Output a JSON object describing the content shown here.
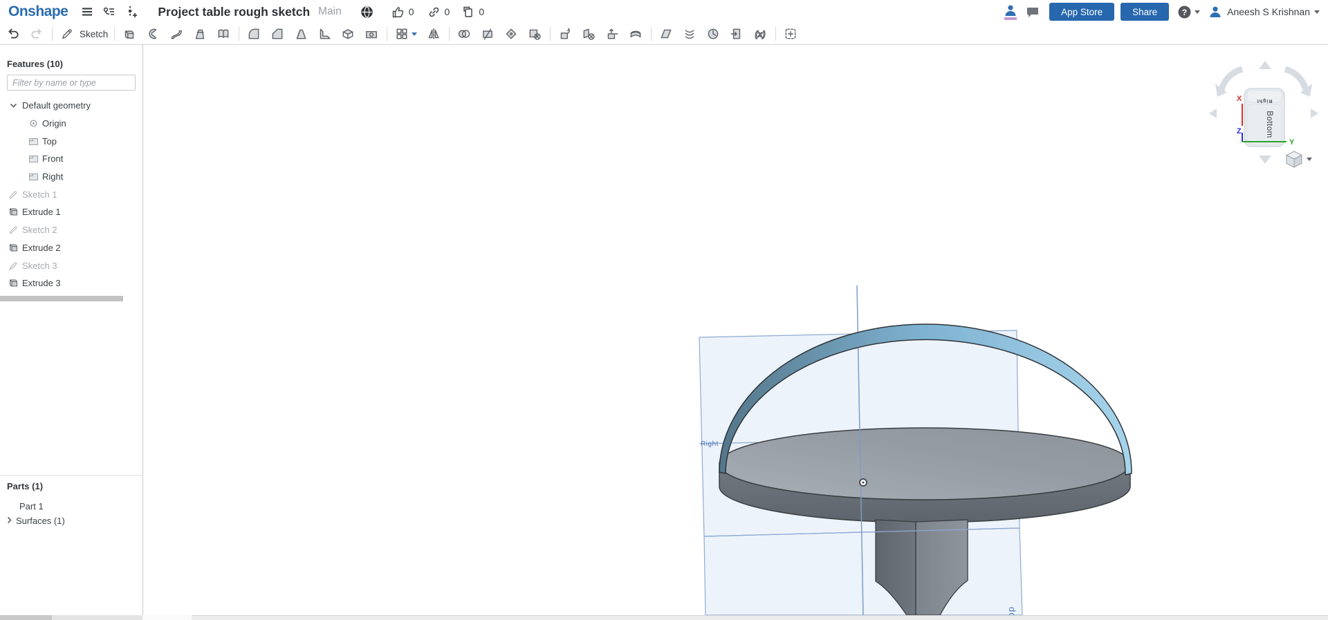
{
  "header": {
    "logo_text": "Onshape",
    "document_title": "Project table rough sketch",
    "workspace_label": "Main",
    "like_count": "0",
    "link_count": "0",
    "copy_count": "0",
    "app_store_button": "App Store",
    "share_button": "Share",
    "user_name": "Aneesh S Krishnan"
  },
  "toolbar": {
    "sketch_label": "Sketch",
    "icon_names": [
      "undo",
      "redo",
      "sketch",
      "extrude",
      "revolve",
      "sweep",
      "loft",
      "thicken",
      "fillet",
      "chamfer",
      "draft",
      "rib",
      "shell",
      "hole",
      "linear-pattern",
      "mirror",
      "boolean",
      "split",
      "modify-fillet",
      "delete-face",
      "move-face",
      "replace-face",
      "transform",
      "offset-surface",
      "plane",
      "helix",
      "point",
      "derived",
      "variable",
      "custom-feature"
    ]
  },
  "features_panel": {
    "title": "Features (10)",
    "filter_placeholder": "Filter by name or type",
    "tree": [
      {
        "label": "Default geometry"
      },
      {
        "label": "Origin"
      },
      {
        "label": "Top"
      },
      {
        "label": "Front"
      },
      {
        "label": "Right"
      },
      {
        "label": "Sketch 1"
      },
      {
        "label": "Extrude 1"
      },
      {
        "label": "Sketch 2"
      },
      {
        "label": "Extrude 2"
      },
      {
        "label": "Sketch 3"
      },
      {
        "label": "Extrude 3"
      }
    ]
  },
  "parts_panel": {
    "title": "Parts (1)",
    "part_label": "Part 1",
    "surfaces_label": "Surfaces (1)"
  },
  "viewport": {
    "plane_label_right": "Right",
    "plane_label_top": "Top",
    "view_cube": {
      "front_face": "Bottom",
      "top_face": "Right",
      "axis_x": "X",
      "axis_y": "Y",
      "axis_z": "Z"
    }
  },
  "colors": {
    "brand_blue": "#2a6db0",
    "button_blue": "#2667ae",
    "axis_x_red": "#d93025",
    "axis_y_green": "#27a327",
    "axis_z_blue": "#2b2bdc",
    "surface_ribbon_blue": "#a7d4eb",
    "part_gray": "#8f969d",
    "plane_edge_blue": "#8fa9d2",
    "plane_label_blue": "#4a75b9"
  }
}
